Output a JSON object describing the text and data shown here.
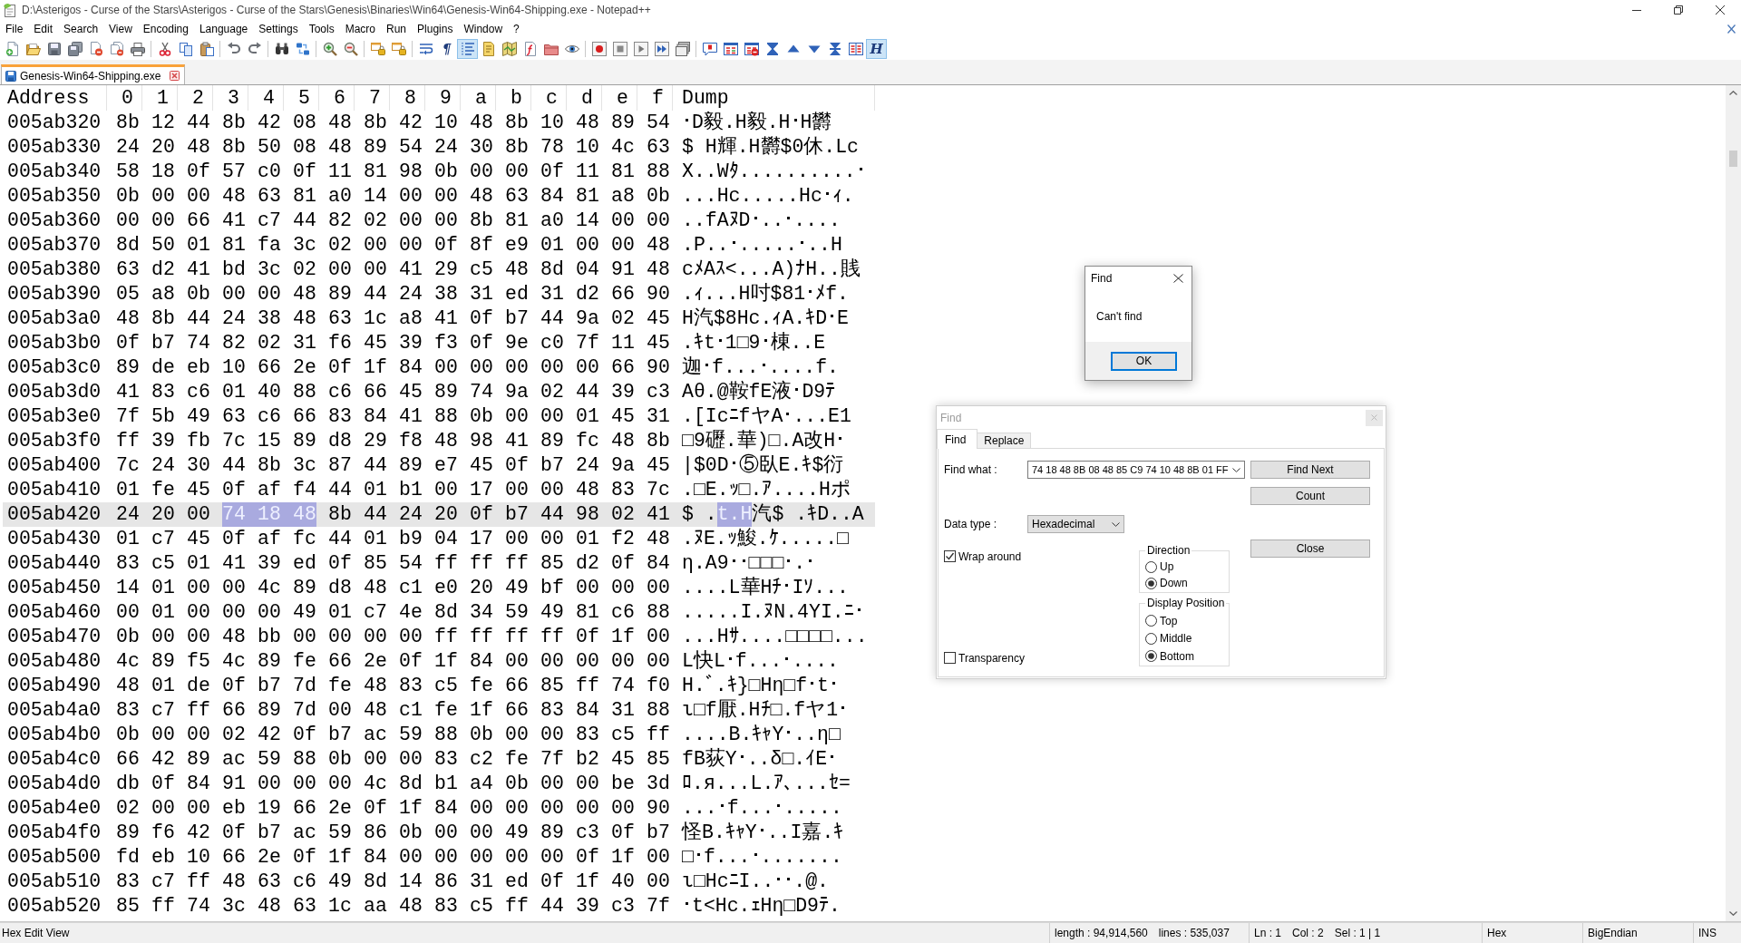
{
  "window": {
    "title": "D:\\Asterigos - Curse of the Stars\\Asterigos - Curse of the Stars\\Genesis\\Binaries\\Win64\\Genesis-Win64-Shipping.exe - Notepad++"
  },
  "menu": [
    "File",
    "Edit",
    "Search",
    "View",
    "Encoding",
    "Language",
    "Settings",
    "Tools",
    "Macro",
    "Run",
    "Plugins",
    "Window",
    "?"
  ],
  "toolbar": [
    {
      "buttons": [
        {
          "kind": "new",
          "pressed": false
        },
        {
          "kind": "open",
          "pressed": false
        },
        {
          "kind": "save",
          "pressed": false
        },
        {
          "kind": "saveall",
          "pressed": false
        },
        {
          "kind": "close",
          "pressed": false
        },
        {
          "kind": "closeall",
          "pressed": false
        },
        {
          "kind": "print",
          "pressed": false
        }
      ]
    },
    {
      "buttons": [
        {
          "kind": "cut",
          "pressed": false
        },
        {
          "kind": "copy",
          "pressed": false
        },
        {
          "kind": "paste",
          "pressed": false
        }
      ]
    },
    {
      "buttons": [
        {
          "kind": "undo",
          "pressed": false
        },
        {
          "kind": "redo",
          "pressed": false
        }
      ]
    },
    {
      "buttons": [
        {
          "kind": "find",
          "pressed": false
        },
        {
          "kind": "replace",
          "pressed": false
        }
      ]
    },
    {
      "buttons": [
        {
          "kind": "zoomin",
          "pressed": false
        },
        {
          "kind": "zoomout",
          "pressed": false
        }
      ]
    },
    {
      "buttons": [
        {
          "kind": "syncv",
          "pressed": false
        },
        {
          "kind": "synch",
          "pressed": false
        }
      ]
    },
    {
      "buttons": [
        {
          "kind": "wrap",
          "pressed": false
        },
        {
          "kind": "letter",
          "label": "¶",
          "pressed": false
        },
        {
          "kind": "indent",
          "pressed": true
        },
        {
          "kind": "udl",
          "pressed": false
        },
        {
          "kind": "docmap",
          "pressed": false
        },
        {
          "kind": "funclist",
          "pressed": false
        },
        {
          "kind": "folder",
          "pressed": false
        },
        {
          "kind": "monitor",
          "pressed": false
        }
      ]
    },
    {
      "buttons": [
        {
          "kind": "record",
          "pressed": false
        },
        {
          "kind": "stop",
          "pressed": false
        },
        {
          "kind": "play",
          "pressed": false
        },
        {
          "kind": "playmulti",
          "pressed": false
        },
        {
          "kind": "savemacro",
          "pressed": false
        }
      ]
    },
    {
      "buttons": [
        {
          "kind": "bubble",
          "pressed": false
        },
        {
          "kind": "table",
          "pressed": false
        },
        {
          "kind": "tableclear",
          "pressed": false
        },
        {
          "kind": "first",
          "pressed": false
        },
        {
          "kind": "prev",
          "pressed": false
        },
        {
          "kind": "next",
          "pressed": false
        },
        {
          "kind": "last",
          "pressed": false
        },
        {
          "kind": "panels",
          "pressed": false
        },
        {
          "kind": "letter",
          "label": "H",
          "pressed": true
        }
      ]
    }
  ],
  "tabs": [
    {
      "label": "Genesis-Win64-Shipping.exe",
      "selected": true
    }
  ],
  "hex_view": {
    "columns": [
      "Address",
      "0",
      "1",
      "2",
      "3",
      "4",
      "5",
      "6",
      "7",
      "8",
      "9",
      "a",
      "b",
      "c",
      "d",
      "e",
      "f",
      "Dump"
    ],
    "rows": [
      {
        "address": "005ab320",
        "current": false,
        "bytes": [
          "8b",
          "12",
          "44",
          "8b",
          "42",
          "08",
          "48",
          "8b",
          "42",
          "10",
          "48",
          "8b",
          "10",
          "48",
          "89",
          "54"
        ],
        "byte_selected": [
          false,
          false,
          false,
          false,
          false,
          false,
          false,
          false,
          false,
          false,
          false,
          false,
          false,
          false,
          false,
          false
        ],
        "dump": [
          {
            "text": "･D毅.H毅.H･H欝",
            "selected": false
          }
        ]
      },
      {
        "address": "005ab330",
        "current": false,
        "bytes": [
          "24",
          "20",
          "48",
          "8b",
          "50",
          "08",
          "48",
          "89",
          "54",
          "24",
          "30",
          "8b",
          "78",
          "10",
          "4c",
          "63"
        ],
        "byte_selected": [
          false,
          false,
          false,
          false,
          false,
          false,
          false,
          false,
          false,
          false,
          false,
          false,
          false,
          false,
          false,
          false
        ],
        "dump": [
          {
            "text": "$ H輝.H欝$0休.Lc",
            "selected": false
          }
        ]
      },
      {
        "address": "005ab340",
        "current": false,
        "bytes": [
          "58",
          "18",
          "0f",
          "57",
          "c0",
          "0f",
          "11",
          "81",
          "98",
          "0b",
          "00",
          "00",
          "0f",
          "11",
          "81",
          "88"
        ],
        "byte_selected": [
          false,
          false,
          false,
          false,
          false,
          false,
          false,
          false,
          false,
          false,
          false,
          false,
          false,
          false,
          false,
          false
        ],
        "dump": [
          {
            "text": "X..Wﾀ..........･",
            "selected": false
          }
        ]
      },
      {
        "address": "005ab350",
        "current": false,
        "bytes": [
          "0b",
          "00",
          "00",
          "48",
          "63",
          "81",
          "a0",
          "14",
          "00",
          "00",
          "48",
          "63",
          "84",
          "81",
          "a8",
          "0b"
        ],
        "byte_selected": [
          false,
          false,
          false,
          false,
          false,
          false,
          false,
          false,
          false,
          false,
          false,
          false,
          false,
          false,
          false,
          false
        ],
        "dump": [
          {
            "text": "...Hc.....Hc･ｨ.",
            "selected": false
          }
        ]
      },
      {
        "address": "005ab360",
        "current": false,
        "bytes": [
          "00",
          "00",
          "66",
          "41",
          "c7",
          "44",
          "82",
          "02",
          "00",
          "00",
          "8b",
          "81",
          "a0",
          "14",
          "00",
          "00"
        ],
        "byte_selected": [
          false,
          false,
          false,
          false,
          false,
          false,
          false,
          false,
          false,
          false,
          false,
          false,
          false,
          false,
          false,
          false
        ],
        "dump": [
          {
            "text": "..fAﾇD･..･....",
            "selected": false
          }
        ]
      },
      {
        "address": "005ab370",
        "current": false,
        "bytes": [
          "8d",
          "50",
          "01",
          "81",
          "fa",
          "3c",
          "02",
          "00",
          "00",
          "0f",
          "8f",
          "e9",
          "01",
          "00",
          "00",
          "48"
        ],
        "byte_selected": [
          false,
          false,
          false,
          false,
          false,
          false,
          false,
          false,
          false,
          false,
          false,
          false,
          false,
          false,
          false,
          false
        ],
        "dump": [
          {
            "text": ".P..･.....･..H",
            "selected": false
          }
        ]
      },
      {
        "address": "005ab380",
        "current": false,
        "bytes": [
          "63",
          "d2",
          "41",
          "bd",
          "3c",
          "02",
          "00",
          "00",
          "41",
          "29",
          "c5",
          "48",
          "8d",
          "04",
          "91",
          "48"
        ],
        "byte_selected": [
          false,
          false,
          false,
          false,
          false,
          false,
          false,
          false,
          false,
          false,
          false,
          false,
          false,
          false,
          false,
          false
        ],
        "dump": [
          {
            "text": "cﾒAｽ<...A)ﾅH..賎",
            "selected": false
          }
        ]
      },
      {
        "address": "005ab390",
        "current": false,
        "bytes": [
          "05",
          "a8",
          "0b",
          "00",
          "00",
          "48",
          "89",
          "44",
          "24",
          "38",
          "31",
          "ed",
          "31",
          "d2",
          "66",
          "90"
        ],
        "byte_selected": [
          false,
          false,
          false,
          false,
          false,
          false,
          false,
          false,
          false,
          false,
          false,
          false,
          false,
          false,
          false,
          false
        ],
        "dump": [
          {
            "text": ".ｨ...H吋$81･ﾒf.",
            "selected": false
          }
        ]
      },
      {
        "address": "005ab3a0",
        "current": false,
        "bytes": [
          "48",
          "8b",
          "44",
          "24",
          "38",
          "48",
          "63",
          "1c",
          "a8",
          "41",
          "0f",
          "b7",
          "44",
          "9a",
          "02",
          "45"
        ],
        "byte_selected": [
          false,
          false,
          false,
          false,
          false,
          false,
          false,
          false,
          false,
          false,
          false,
          false,
          false,
          false,
          false,
          false
        ],
        "dump": [
          {
            "text": "H汽$8Hc.ｨA.ｷD･E",
            "selected": false
          }
        ]
      },
      {
        "address": "005ab3b0",
        "current": false,
        "bytes": [
          "0f",
          "b7",
          "74",
          "82",
          "02",
          "31",
          "f6",
          "45",
          "39",
          "f3",
          "0f",
          "9e",
          "c0",
          "7f",
          "11",
          "45"
        ],
        "byte_selected": [
          false,
          false,
          false,
          false,
          false,
          false,
          false,
          false,
          false,
          false,
          false,
          false,
          false,
          false,
          false,
          false
        ],
        "dump": [
          {
            "text": ".ｷt･1□9･棟..E",
            "selected": false
          }
        ]
      },
      {
        "address": "005ab3c0",
        "current": false,
        "bytes": [
          "89",
          "de",
          "eb",
          "10",
          "66",
          "2e",
          "0f",
          "1f",
          "84",
          "00",
          "00",
          "00",
          "00",
          "00",
          "66",
          "90"
        ],
        "byte_selected": [
          false,
          false,
          false,
          false,
          false,
          false,
          false,
          false,
          false,
          false,
          false,
          false,
          false,
          false,
          false,
          false
        ],
        "dump": [
          {
            "text": "迦･f...･....f.",
            "selected": false
          }
        ]
      },
      {
        "address": "005ab3d0",
        "current": false,
        "bytes": [
          "41",
          "83",
          "c6",
          "01",
          "40",
          "88",
          "c6",
          "66",
          "45",
          "89",
          "74",
          "9a",
          "02",
          "44",
          "39",
          "c3"
        ],
        "byte_selected": [
          false,
          false,
          false,
          false,
          false,
          false,
          false,
          false,
          false,
          false,
          false,
          false,
          false,
          false,
          false,
          false
        ],
        "dump": [
          {
            "text": "Aθ.@鞍fE液･D9ﾃ",
            "selected": false
          }
        ]
      },
      {
        "address": "005ab3e0",
        "current": false,
        "bytes": [
          "7f",
          "5b",
          "49",
          "63",
          "c6",
          "66",
          "83",
          "84",
          "41",
          "88",
          "0b",
          "00",
          "00",
          "01",
          "45",
          "31"
        ],
        "byte_selected": [
          false,
          false,
          false,
          false,
          false,
          false,
          false,
          false,
          false,
          false,
          false,
          false,
          false,
          false,
          false,
          false
        ],
        "dump": [
          {
            "text": ".[IcﾆfヤA･...E1",
            "selected": false
          }
        ]
      },
      {
        "address": "005ab3f0",
        "current": false,
        "bytes": [
          "ff",
          "39",
          "fb",
          "7c",
          "15",
          "89",
          "d8",
          "29",
          "f8",
          "48",
          "98",
          "41",
          "89",
          "fc",
          "48",
          "8b"
        ],
        "byte_selected": [
          false,
          false,
          false,
          false,
          false,
          false,
          false,
          false,
          false,
          false,
          false,
          false,
          false,
          false,
          false,
          false
        ],
        "dump": [
          {
            "text": "□9礰.華)□.A改H･",
            "selected": false
          }
        ]
      },
      {
        "address": "005ab400",
        "current": false,
        "bytes": [
          "7c",
          "24",
          "30",
          "44",
          "8b",
          "3c",
          "87",
          "44",
          "89",
          "e7",
          "45",
          "0f",
          "b7",
          "24",
          "9a",
          "45"
        ],
        "byte_selected": [
          false,
          false,
          false,
          false,
          false,
          false,
          false,
          false,
          false,
          false,
          false,
          false,
          false,
          false,
          false,
          false
        ],
        "dump": [
          {
            "text": "|$0D･⑤臥E.ｷ$衍",
            "selected": false
          }
        ]
      },
      {
        "address": "005ab410",
        "current": false,
        "bytes": [
          "01",
          "fe",
          "45",
          "0f",
          "af",
          "f4",
          "44",
          "01",
          "b1",
          "00",
          "17",
          "00",
          "00",
          "48",
          "83",
          "7c"
        ],
        "byte_selected": [
          false,
          false,
          false,
          false,
          false,
          false,
          false,
          false,
          false,
          false,
          false,
          false,
          false,
          false,
          false,
          false
        ],
        "dump": [
          {
            "text": ".□E.ｯ□.ｱ....Hポ",
            "selected": false
          }
        ]
      },
      {
        "address": "005ab420",
        "current": true,
        "bytes": [
          "24",
          "20",
          "00",
          "74",
          "18",
          "48",
          "8b",
          "44",
          "24",
          "20",
          "0f",
          "b7",
          "44",
          "98",
          "02",
          "41"
        ],
        "byte_selected": [
          false,
          false,
          false,
          true,
          true,
          true,
          false,
          false,
          false,
          false,
          false,
          false,
          false,
          false,
          false,
          false
        ],
        "dump": [
          {
            "text": "$ .",
            "selected": false
          },
          {
            "text": "t.H",
            "selected": true
          },
          {
            "text": "汽$ .ｷD..A",
            "selected": false
          }
        ]
      },
      {
        "address": "005ab430",
        "current": false,
        "bytes": [
          "01",
          "c7",
          "45",
          "0f",
          "af",
          "fc",
          "44",
          "01",
          "b9",
          "04",
          "17",
          "00",
          "00",
          "01",
          "f2",
          "48"
        ],
        "byte_selected": [
          false,
          false,
          false,
          false,
          false,
          false,
          false,
          false,
          false,
          false,
          false,
          false,
          false,
          false,
          false,
          false
        ],
        "dump": [
          {
            "text": ".ﾇE.ｯ鮻.ｹ.....□",
            "selected": false
          }
        ]
      },
      {
        "address": "005ab440",
        "current": false,
        "bytes": [
          "83",
          "c5",
          "01",
          "41",
          "39",
          "ed",
          "0f",
          "85",
          "54",
          "ff",
          "ff",
          "ff",
          "85",
          "d2",
          "0f",
          "84"
        ],
        "byte_selected": [
          false,
          false,
          false,
          false,
          false,
          false,
          false,
          false,
          false,
          false,
          false,
          false,
          false,
          false,
          false,
          false
        ],
        "dump": [
          {
            "text": "η.A9･･□□□･.･",
            "selected": false
          }
        ]
      },
      {
        "address": "005ab450",
        "current": false,
        "bytes": [
          "14",
          "01",
          "00",
          "00",
          "4c",
          "89",
          "d8",
          "48",
          "c1",
          "e0",
          "20",
          "49",
          "bf",
          "00",
          "00",
          "00"
        ],
        "byte_selected": [
          false,
          false,
          false,
          false,
          false,
          false,
          false,
          false,
          false,
          false,
          false,
          false,
          false,
          false,
          false,
          false
        ],
        "dump": [
          {
            "text": "....L華Hﾁ･Iｿ...",
            "selected": false
          }
        ]
      },
      {
        "address": "005ab460",
        "current": false,
        "bytes": [
          "00",
          "01",
          "00",
          "00",
          "00",
          "49",
          "01",
          "c7",
          "4e",
          "8d",
          "34",
          "59",
          "49",
          "81",
          "c6",
          "88"
        ],
        "byte_selected": [
          false,
          false,
          false,
          false,
          false,
          false,
          false,
          false,
          false,
          false,
          false,
          false,
          false,
          false,
          false,
          false
        ],
        "dump": [
          {
            "text": ".....I.ﾇN.4YI.ﾆ･",
            "selected": false
          }
        ]
      },
      {
        "address": "005ab470",
        "current": false,
        "bytes": [
          "0b",
          "00",
          "00",
          "48",
          "bb",
          "00",
          "00",
          "00",
          "00",
          "ff",
          "ff",
          "ff",
          "ff",
          "0f",
          "1f",
          "00"
        ],
        "byte_selected": [
          false,
          false,
          false,
          false,
          false,
          false,
          false,
          false,
          false,
          false,
          false,
          false,
          false,
          false,
          false,
          false
        ],
        "dump": [
          {
            "text": "...Hｻ....□□□□...",
            "selected": false
          }
        ]
      },
      {
        "address": "005ab480",
        "current": false,
        "bytes": [
          "4c",
          "89",
          "f5",
          "4c",
          "89",
          "fe",
          "66",
          "2e",
          "0f",
          "1f",
          "84",
          "00",
          "00",
          "00",
          "00",
          "00"
        ],
        "byte_selected": [
          false,
          false,
          false,
          false,
          false,
          false,
          false,
          false,
          false,
          false,
          false,
          false,
          false,
          false,
          false,
          false
        ],
        "dump": [
          {
            "text": "L快L･f...･....",
            "selected": false
          }
        ]
      },
      {
        "address": "005ab490",
        "current": false,
        "bytes": [
          "48",
          "01",
          "de",
          "0f",
          "b7",
          "7d",
          "fe",
          "48",
          "83",
          "c5",
          "fe",
          "66",
          "85",
          "ff",
          "74",
          "f0"
        ],
        "byte_selected": [
          false,
          false,
          false,
          false,
          false,
          false,
          false,
          false,
          false,
          false,
          false,
          false,
          false,
          false,
          false,
          false
        ],
        "dump": [
          {
            "text": "H.ﾞ.ｷ}□Hη□f･t･",
            "selected": false
          }
        ]
      },
      {
        "address": "005ab4a0",
        "current": false,
        "bytes": [
          "83",
          "c7",
          "ff",
          "66",
          "89",
          "7d",
          "00",
          "48",
          "c1",
          "fe",
          "1f",
          "66",
          "83",
          "84",
          "31",
          "88"
        ],
        "byte_selected": [
          false,
          false,
          false,
          false,
          false,
          false,
          false,
          false,
          false,
          false,
          false,
          false,
          false,
          false,
          false,
          false
        ],
        "dump": [
          {
            "text": "ι□f厭.Hﾁ□.fヤ1･",
            "selected": false
          }
        ]
      },
      {
        "address": "005ab4b0",
        "current": false,
        "bytes": [
          "0b",
          "00",
          "00",
          "02",
          "42",
          "0f",
          "b7",
          "ac",
          "59",
          "88",
          "0b",
          "00",
          "00",
          "83",
          "c5",
          "ff"
        ],
        "byte_selected": [
          false,
          false,
          false,
          false,
          false,
          false,
          false,
          false,
          false,
          false,
          false,
          false,
          false,
          false,
          false,
          false
        ],
        "dump": [
          {
            "text": "....B.ｷｬY･..η□",
            "selected": false
          }
        ]
      },
      {
        "address": "005ab4c0",
        "current": false,
        "bytes": [
          "66",
          "42",
          "89",
          "ac",
          "59",
          "88",
          "0b",
          "00",
          "00",
          "83",
          "c2",
          "fe",
          "7f",
          "b2",
          "45",
          "85"
        ],
        "byte_selected": [
          false,
          false,
          false,
          false,
          false,
          false,
          false,
          false,
          false,
          false,
          false,
          false,
          false,
          false,
          false,
          false
        ],
        "dump": [
          {
            "text": "fB荻Y･..δ□.ｲE･",
            "selected": false
          }
        ]
      },
      {
        "address": "005ab4d0",
        "current": false,
        "bytes": [
          "db",
          "0f",
          "84",
          "91",
          "00",
          "00",
          "00",
          "4c",
          "8d",
          "b1",
          "a4",
          "0b",
          "00",
          "00",
          "be",
          "3d"
        ],
        "byte_selected": [
          false,
          false,
          false,
          false,
          false,
          false,
          false,
          false,
          false,
          false,
          false,
          false,
          false,
          false,
          false,
          false
        ],
        "dump": [
          {
            "text": "ﾛ.я...L.ｱ､...ｾ=",
            "selected": false
          }
        ]
      },
      {
        "address": "005ab4e0",
        "current": false,
        "bytes": [
          "02",
          "00",
          "00",
          "eb",
          "19",
          "66",
          "2e",
          "0f",
          "1f",
          "84",
          "00",
          "00",
          "00",
          "00",
          "00",
          "90"
        ],
        "byte_selected": [
          false,
          false,
          false,
          false,
          false,
          false,
          false,
          false,
          false,
          false,
          false,
          false,
          false,
          false,
          false,
          false
        ],
        "dump": [
          {
            "text": "...･f...･.....",
            "selected": false
          }
        ]
      },
      {
        "address": "005ab4f0",
        "current": false,
        "bytes": [
          "89",
          "f6",
          "42",
          "0f",
          "b7",
          "ac",
          "59",
          "86",
          "0b",
          "00",
          "00",
          "49",
          "89",
          "c3",
          "0f",
          "b7"
        ],
        "byte_selected": [
          false,
          false,
          false,
          false,
          false,
          false,
          false,
          false,
          false,
          false,
          false,
          false,
          false,
          false,
          false,
          false
        ],
        "dump": [
          {
            "text": "怪B.ｷｬY･..I嘉.ｷ",
            "selected": false
          }
        ]
      },
      {
        "address": "005ab500",
        "current": false,
        "bytes": [
          "fd",
          "eb",
          "10",
          "66",
          "2e",
          "0f",
          "1f",
          "84",
          "00",
          "00",
          "00",
          "00",
          "00",
          "0f",
          "1f",
          "00"
        ],
        "byte_selected": [
          false,
          false,
          false,
          false,
          false,
          false,
          false,
          false,
          false,
          false,
          false,
          false,
          false,
          false,
          false,
          false
        ],
        "dump": [
          {
            "text": "□･f...･.......",
            "selected": false
          }
        ]
      },
      {
        "address": "005ab510",
        "current": false,
        "bytes": [
          "83",
          "c7",
          "ff",
          "48",
          "63",
          "c6",
          "49",
          "8d",
          "14",
          "86",
          "31",
          "ed",
          "0f",
          "1f",
          "40",
          "00"
        ],
        "byte_selected": [
          false,
          false,
          false,
          false,
          false,
          false,
          false,
          false,
          false,
          false,
          false,
          false,
          false,
          false,
          false,
          false
        ],
        "dump": [
          {
            "text": "ι□HcﾆI..･･.@.",
            "selected": false
          }
        ]
      },
      {
        "address": "005ab520",
        "current": false,
        "bytes": [
          "85",
          "ff",
          "74",
          "3c",
          "48",
          "63",
          "1c",
          "aa",
          "48",
          "83",
          "c5",
          "ff",
          "44",
          "39",
          "c3",
          "7f"
        ],
        "byte_selected": [
          false,
          false,
          false,
          false,
          false,
          false,
          false,
          false,
          false,
          false,
          false,
          false,
          false,
          false,
          false,
          false
        ],
        "dump": [
          {
            "text": "･t<Hc.ｪHη□D9ﾃ.",
            "selected": false
          }
        ]
      }
    ]
  },
  "status_bar": {
    "mode": "Hex Edit View",
    "length": "length : 94,914,560",
    "lines": "lines : 535,037",
    "position": [
      "Ln : 1",
      "Col : 2",
      "Sel : 1 | 1"
    ],
    "eol": "Hex",
    "encoding": "BigEndian",
    "typing": "INS"
  },
  "message_box": {
    "title": "Find",
    "active": true,
    "message": "Can't find",
    "button": {
      "label": "OK",
      "focused": true
    }
  },
  "find_dialog": {
    "title": "Find",
    "active": false,
    "tabs": [
      {
        "label": "Find",
        "selected": true
      },
      {
        "label": "Replace",
        "selected": false
      }
    ],
    "find_what": {
      "label": "Find what :",
      "value": "74 18 48 8B 08 48 85 C9 74 10 48 8B 01 FF"
    },
    "data_type": {
      "label": "Data type :",
      "value": "Hexadecimal"
    },
    "buttons": [
      "Find Next",
      "Count"
    ],
    "close_button": "Close",
    "wrap_around": {
      "label": "Wrap around",
      "checked": true
    },
    "transparency": {
      "label": "Transparency",
      "checked": false
    },
    "direction": {
      "title": "Direction",
      "options": [
        {
          "label": "Up",
          "selected": false
        },
        {
          "label": "Down",
          "selected": true
        }
      ]
    },
    "display_position": {
      "title": "Display Position",
      "options": [
        {
          "label": "Top",
          "selected": false
        },
        {
          "label": "Middle",
          "selected": false
        },
        {
          "label": "Bottom",
          "selected": true
        }
      ]
    }
  }
}
